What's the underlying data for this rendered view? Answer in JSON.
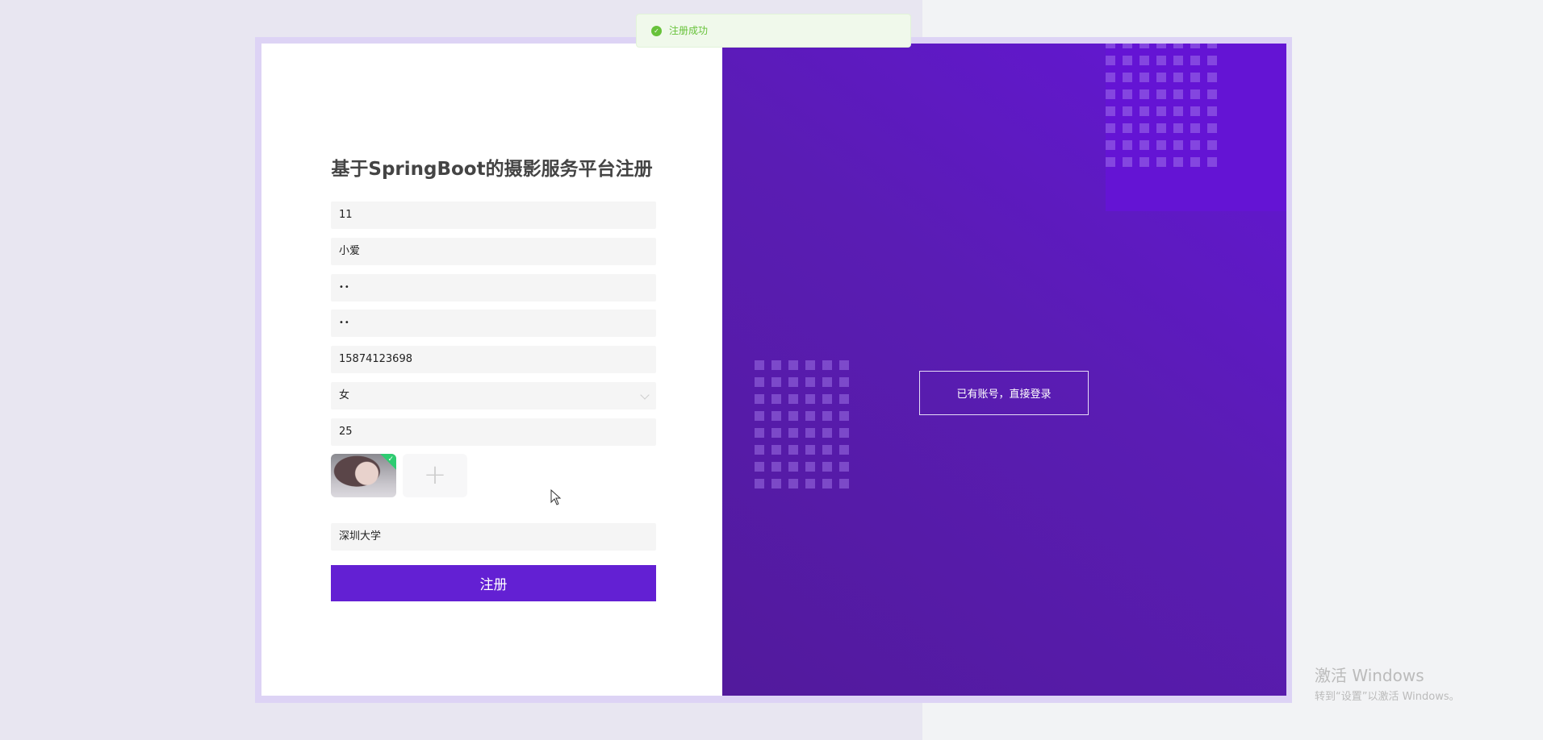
{
  "toast": {
    "message": "注册成功",
    "icon": "success-check-icon",
    "color": "#67c23a"
  },
  "form": {
    "title": "基于SpringBoot的摄影服务平台注册",
    "account": "11",
    "name": "小爱",
    "password": "••",
    "confirm_password": "••",
    "phone": "15874123698",
    "gender": "女",
    "age": "25",
    "upload_plus": "+",
    "school": "深圳大学",
    "submit_label": "注册"
  },
  "side": {
    "login_label": "已有账号，直接登录"
  },
  "colors": {
    "accent": "#6320d3",
    "panel": "#5a1cb4"
  },
  "watermark": {
    "line1": "激活 Windows",
    "line2": "转到“设置”以激活 Windows。"
  }
}
